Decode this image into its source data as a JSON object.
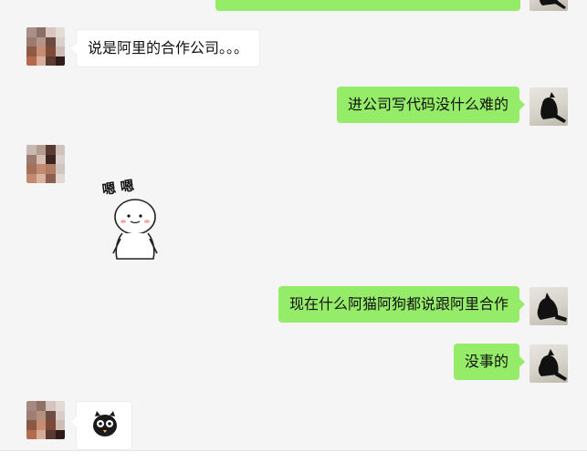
{
  "messages": [
    {
      "side": "in",
      "kind": "text",
      "text": "说是阿里的合作公司。。。"
    },
    {
      "side": "out",
      "kind": "text",
      "text": "进公司写代码没什么难的"
    },
    {
      "side": "in",
      "kind": "sticker",
      "text": "嗯 嗯",
      "sticker": "nodding-figure-sticker"
    },
    {
      "side": "out",
      "kind": "text",
      "text": "现在什么阿猫阿狗都说跟阿里合作"
    },
    {
      "side": "out",
      "kind": "text",
      "text": "没事的"
    },
    {
      "side": "in",
      "kind": "emoji",
      "emoji": "black-owl-face-emoji"
    }
  ],
  "colors": {
    "background": "#f5f5f5",
    "bubble_out": "#95ec69",
    "bubble_in": "#ffffff"
  }
}
